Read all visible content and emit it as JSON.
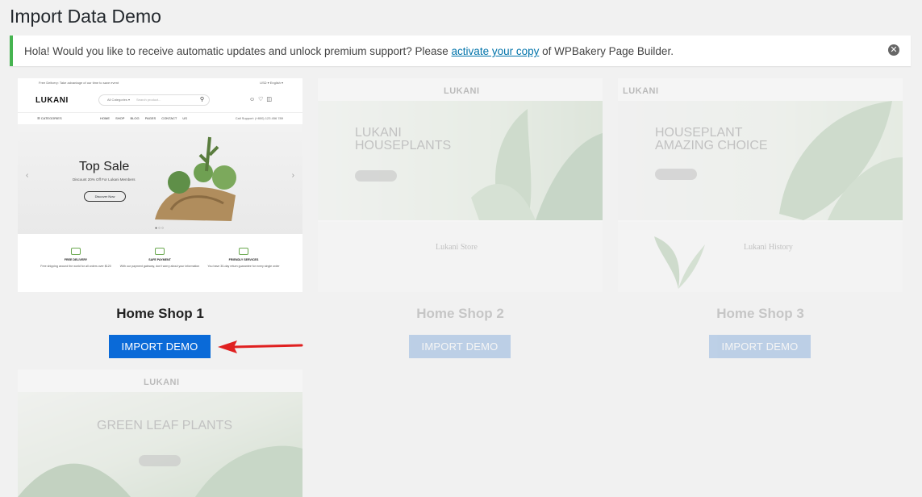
{
  "page": {
    "title": "Import Data Demo"
  },
  "notice": {
    "text_before": "Hola! Would you like to receive automatic updates and unlock premium support? Please ",
    "link_text": "activate your copy",
    "text_after": " of WPBakery Page Builder.",
    "dismiss_icon": "✕"
  },
  "demos": [
    {
      "title": "Home Shop 1",
      "button": "IMPORT DEMO",
      "thumb": {
        "topbar_left": "Free Delivery: Take advantage of our time to save event",
        "topbar_right": "USD ▾   English ▾",
        "logo": "LUKANI",
        "search_category": "All Categories ▾",
        "search_placeholder": "Search product...",
        "nav_categories": "☰  CATEGORIES",
        "nav_links": "HOME SHOP BLOG PAGES CONTACT US",
        "nav_phone": "Call Support: (+800) 123 456 789",
        "hero_title": "Top Sale",
        "hero_sub": "Discount 20% Off For Lukani Members",
        "hero_button": "Discover Now",
        "features": [
          {
            "name": "FREE DELIVERY",
            "text": "Free shipping around the world for all orders over $120"
          },
          {
            "name": "SAFE PAYMENT",
            "text": "With our payment gateway, don't worry about your information"
          },
          {
            "name": "FRIENDLY SERVICES",
            "text": "You have 30-day return guarantee for every single order"
          }
        ]
      }
    },
    {
      "title": "Home Shop 2",
      "button": "IMPORT DEMO",
      "thumb": {
        "logo": "LUKANI",
        "hero_line1": "LUKANI",
        "hero_line2": "HOUSEPLANTS",
        "lower_title": "Lukani Store"
      }
    },
    {
      "title": "Home Shop 3",
      "button": "IMPORT DEMO",
      "thumb": {
        "logo": "LUKANI",
        "hero_line1": "HOUSEPLANT",
        "hero_line2": "AMAZING CHOICE",
        "lower_title": "Lukani History"
      }
    },
    {
      "title": "",
      "button": "",
      "thumb": {
        "logo": "LUKANI",
        "hero_line1": "GREEN LEAF PLANTS"
      }
    }
  ],
  "colors": {
    "accent": "#0a6ad8",
    "notice_border": "#46b450",
    "arrow": "#e02020"
  }
}
